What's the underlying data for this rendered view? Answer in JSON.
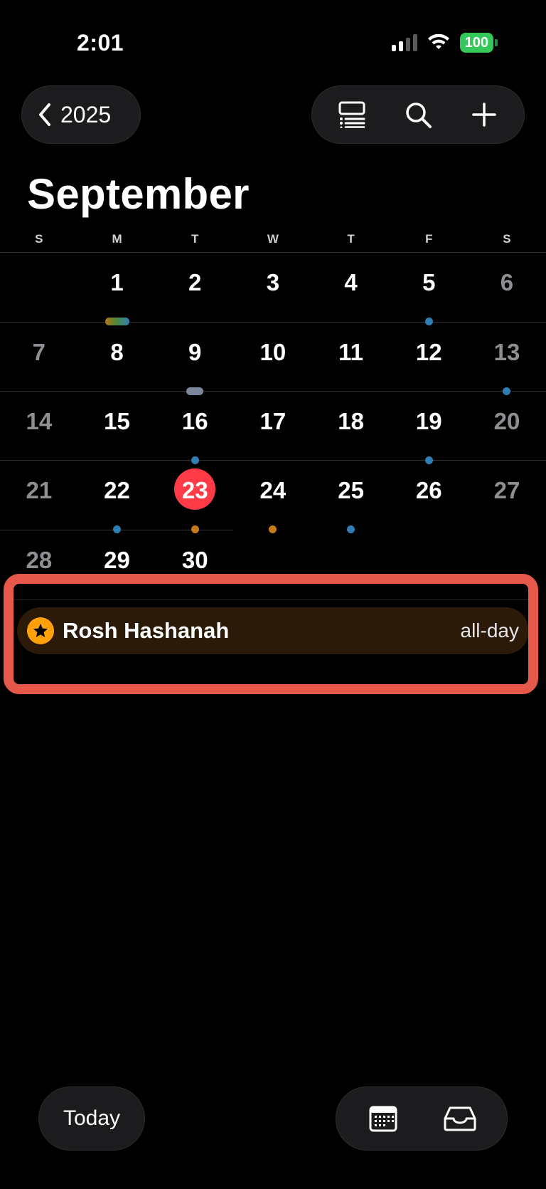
{
  "status_bar": {
    "time": "2:01",
    "battery": "100"
  },
  "header": {
    "back_label": "2025",
    "month": "September"
  },
  "weekdays": [
    "S",
    "M",
    "T",
    "W",
    "T",
    "F",
    "S"
  ],
  "days": {
    "d1": "1",
    "d2": "2",
    "d3": "3",
    "d4": "4",
    "d5": "5",
    "d6": "6",
    "d7": "7",
    "d8": "8",
    "d9": "9",
    "d10": "10",
    "d11": "11",
    "d12": "12",
    "d13": "13",
    "d14": "14",
    "d15": "15",
    "d16": "16",
    "d17": "17",
    "d18": "18",
    "d19": "19",
    "d20": "20",
    "d21": "21",
    "d22": "22",
    "d23": "23",
    "d24": "24",
    "d25": "25",
    "d26": "26",
    "d27": "27",
    "d28": "28",
    "d29": "29",
    "d30": "30"
  },
  "selected_day": "23",
  "event": {
    "title": "Rosh Hashanah",
    "time": "all-day"
  },
  "bottom": {
    "today_label": "Today"
  },
  "colors": {
    "accent_red": "#ff3b48",
    "dot_blue": "#2f7fb5",
    "dot_orange": "#c77a18",
    "holiday_orange": "#ff9f0a",
    "battery_green": "#34c759",
    "highlight": "#e5584a"
  },
  "icons": [
    "chevron-left-icon",
    "list-view-icon",
    "search-icon",
    "plus-icon",
    "calendar-grid-icon",
    "inbox-icon",
    "star-icon"
  ]
}
